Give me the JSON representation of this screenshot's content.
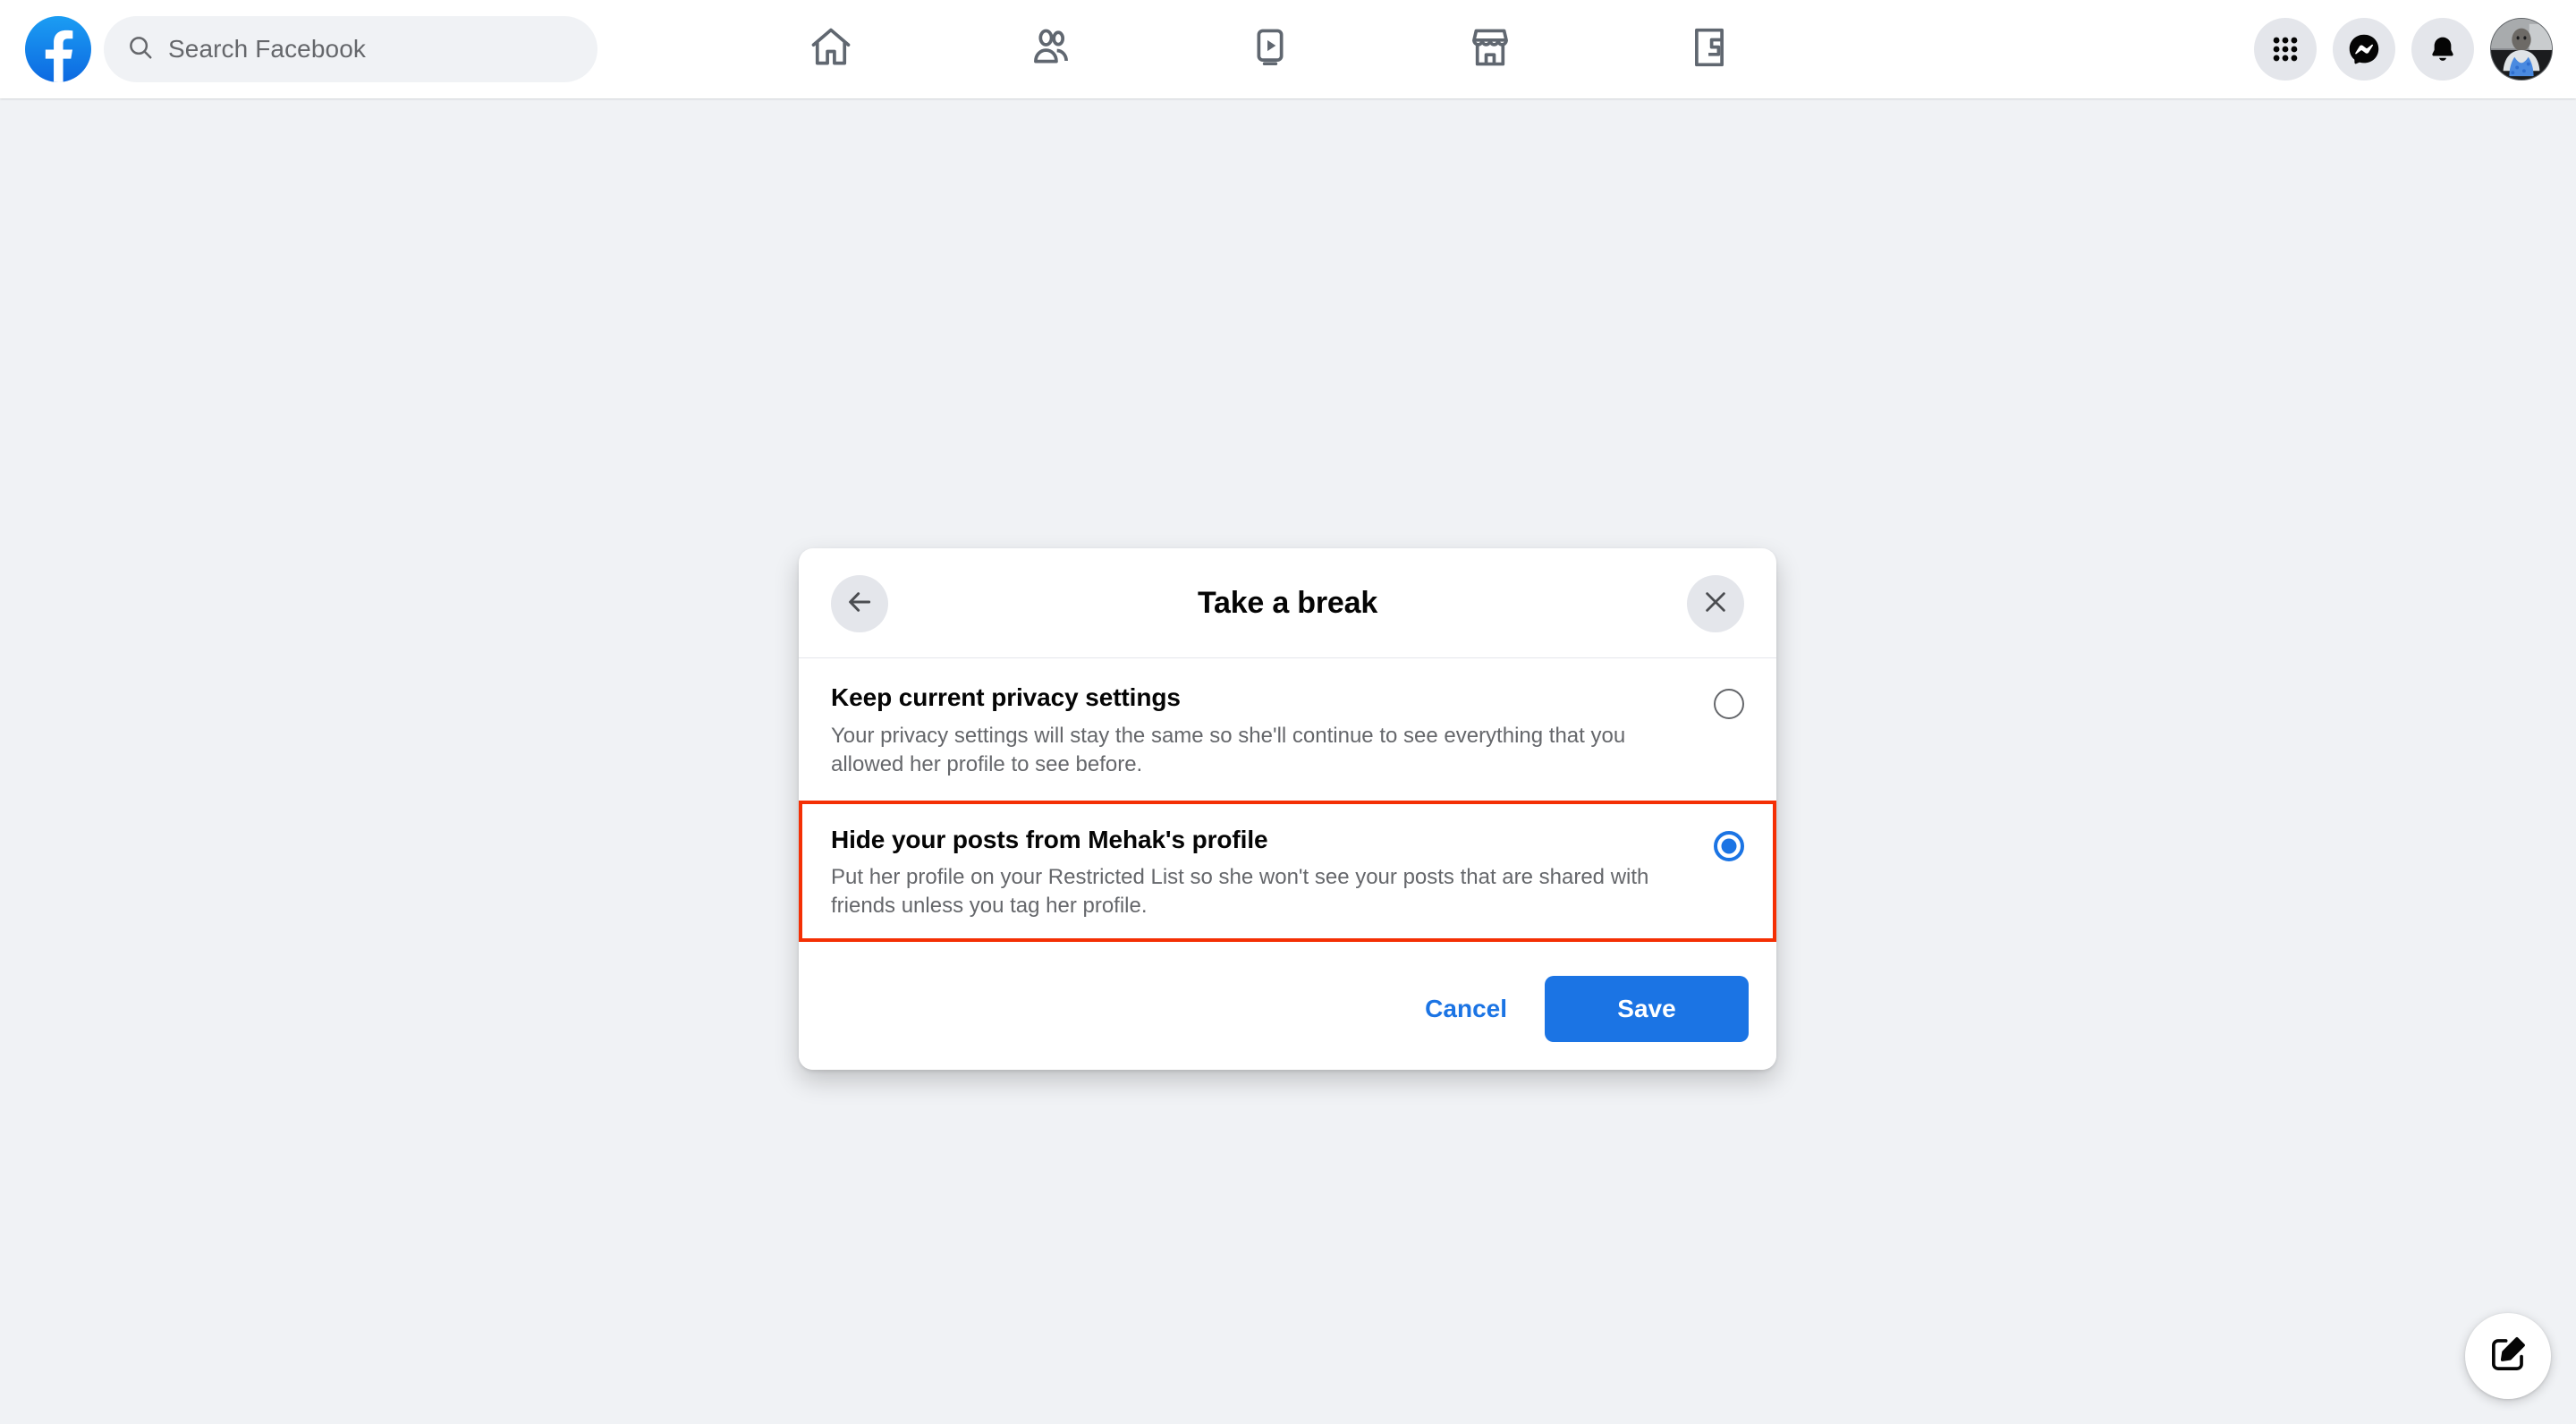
{
  "topbar": {
    "logo_icon": "facebook-logo-icon",
    "search": {
      "icon": "search-icon",
      "placeholder": "Search Facebook",
      "value": ""
    },
    "tabs": [
      {
        "name": "home",
        "icon": "home-icon",
        "label": "Home"
      },
      {
        "name": "friends",
        "icon": "friends-icon",
        "label": "Friends"
      },
      {
        "name": "video",
        "icon": "video-icon",
        "label": "Video"
      },
      {
        "name": "marketplace",
        "icon": "marketplace-icon",
        "label": "Marketplace"
      },
      {
        "name": "gaming",
        "icon": "gaming-icon",
        "label": "Gaming"
      }
    ],
    "actions": [
      {
        "name": "menu",
        "icon": "grid-menu-icon",
        "label": "Menu"
      },
      {
        "name": "messenger",
        "icon": "messenger-icon",
        "label": "Messenger"
      },
      {
        "name": "notifications",
        "icon": "bell-icon",
        "label": "Notifications"
      },
      {
        "name": "account",
        "icon": "avatar-icon",
        "label": "Account"
      }
    ]
  },
  "dialog": {
    "title": "Take a break",
    "back_icon": "arrow-left-icon",
    "close_icon": "close-icon",
    "options": [
      {
        "title": "Keep current privacy settings",
        "description": "Your privacy settings will stay the same so she'll continue to see everything that you allowed her profile to see before.",
        "selected": false,
        "highlighted": false
      },
      {
        "title": "Hide your posts from Mehak's profile",
        "description": "Put her profile on your Restricted List so she won't see your posts that are shared with friends unless you tag her profile.",
        "selected": true,
        "highlighted": true
      }
    ],
    "cancel_label": "Cancel",
    "save_label": "Save"
  },
  "fab": {
    "icon": "compose-icon",
    "label": "Create post"
  },
  "colors": {
    "accent": "#1b74e4",
    "page_background": "#f0f2f5",
    "highlight_outline": "#f42f04",
    "primary_text": "#050505",
    "secondary_text": "#65676b"
  }
}
